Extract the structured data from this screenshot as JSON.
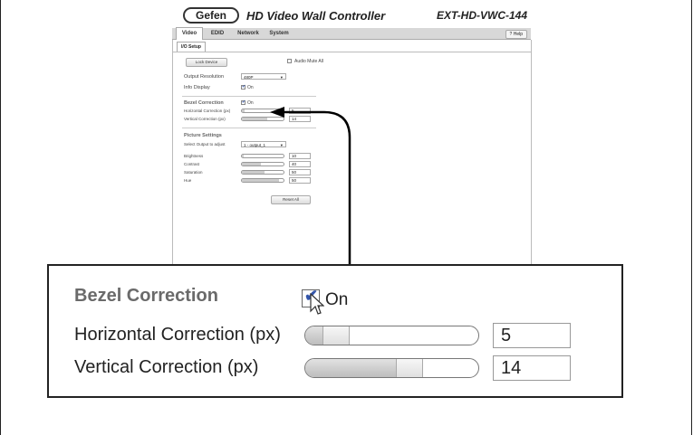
{
  "app": {
    "logo_text": "Gefen",
    "title": "HD Video Wall Controller",
    "model": "EXT-HD-VWC-144"
  },
  "tabs": [
    {
      "label": "Video",
      "active": true
    },
    {
      "label": "EDID",
      "active": false
    },
    {
      "label": "Network",
      "active": false
    },
    {
      "label": "System",
      "active": false
    }
  ],
  "help_label": "? Help",
  "subtab_label": "I/O Setup",
  "settings": {
    "lock_button": "Lock Device",
    "audio_mute_label": "Audio Mute All",
    "output_resolution_label": "Output Resolution",
    "output_resolution_value": "480P",
    "info_display_label": "Info Display",
    "info_display_on": "On",
    "bezel_heading": "Bezel Correction",
    "bezel_on": "On",
    "horizontal_label": "Horizontal Correction (px)",
    "horizontal_value": "5",
    "horizontal_level": 0.07,
    "vertical_label": "Vertical Correction (px)",
    "vertical_value": "14",
    "vertical_level": 0.6,
    "picture_heading": "Picture Settings",
    "select_output_label": "Select Output to adjust",
    "select_output_value": "1 - output_1",
    "brightness_label": "Brightness",
    "brightness_value": "10",
    "brightness_level": 0.05,
    "contrast_label": "Contrast",
    "contrast_value": "40",
    "contrast_level": 0.45,
    "saturation_label": "Saturation",
    "saturation_value": "50",
    "saturation_level": 0.55,
    "hue_label": "Hue",
    "hue_value": "50",
    "hue_level": 0.9,
    "reset_button": "Reset All"
  },
  "zoom": {
    "bezel_heading": "Bezel Correction",
    "bezel_on": "On",
    "horizontal_label": "Horizontal Correction (px)",
    "horizontal_value": "5",
    "horizontal_level": 0.18,
    "vertical_label": "Vertical Correction (px)",
    "vertical_value": "14",
    "vertical_level": 0.6
  },
  "colors": {
    "checkmark": "#3355aa",
    "heading_gray": "#6a6a6a"
  },
  "icons": [
    "checkbox-checked-icon",
    "mouse-pointer-icon",
    "dropdown-arrow-icon",
    "callout-arrow-icon"
  ]
}
